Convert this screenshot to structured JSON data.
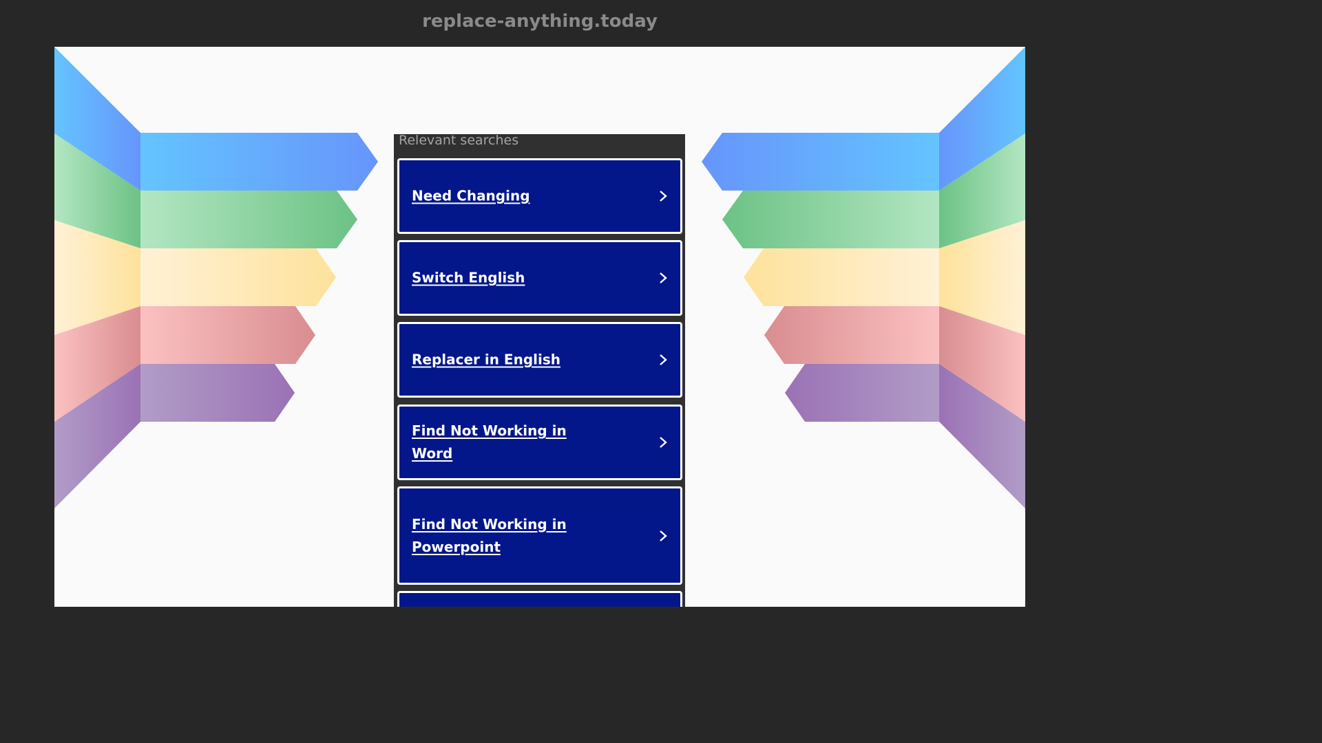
{
  "header": {
    "domain": "replace-anything.today"
  },
  "panel": {
    "heading": "Relevant searches",
    "results": [
      {
        "label": "Need Changing"
      },
      {
        "label": "Switch English"
      },
      {
        "label": "Replacer in English"
      },
      {
        "label": "Find Not Working in Word"
      },
      {
        "label": "Find Not Working in Powerpoint"
      },
      {
        "label": ""
      }
    ]
  },
  "colors": {
    "page_background": "#272727",
    "canvas_background": "#fafafa",
    "panel_background": "#303030",
    "result_background": "#03178a",
    "result_border": "#ffffff",
    "stripe_blue": [
      "#64c4ff",
      "#6695fb"
    ],
    "stripe_green": [
      "#b3e6c2",
      "#6cc285"
    ],
    "stripe_yellow": [
      "#fff1d6",
      "#fee29b"
    ],
    "stripe_red": [
      "#fbc1c1",
      "#d98d90"
    ],
    "stripe_purple": [
      "#b19cc7",
      "#9b72b5"
    ]
  },
  "icons": {
    "result_arrow": "chevron-right-icon"
  }
}
